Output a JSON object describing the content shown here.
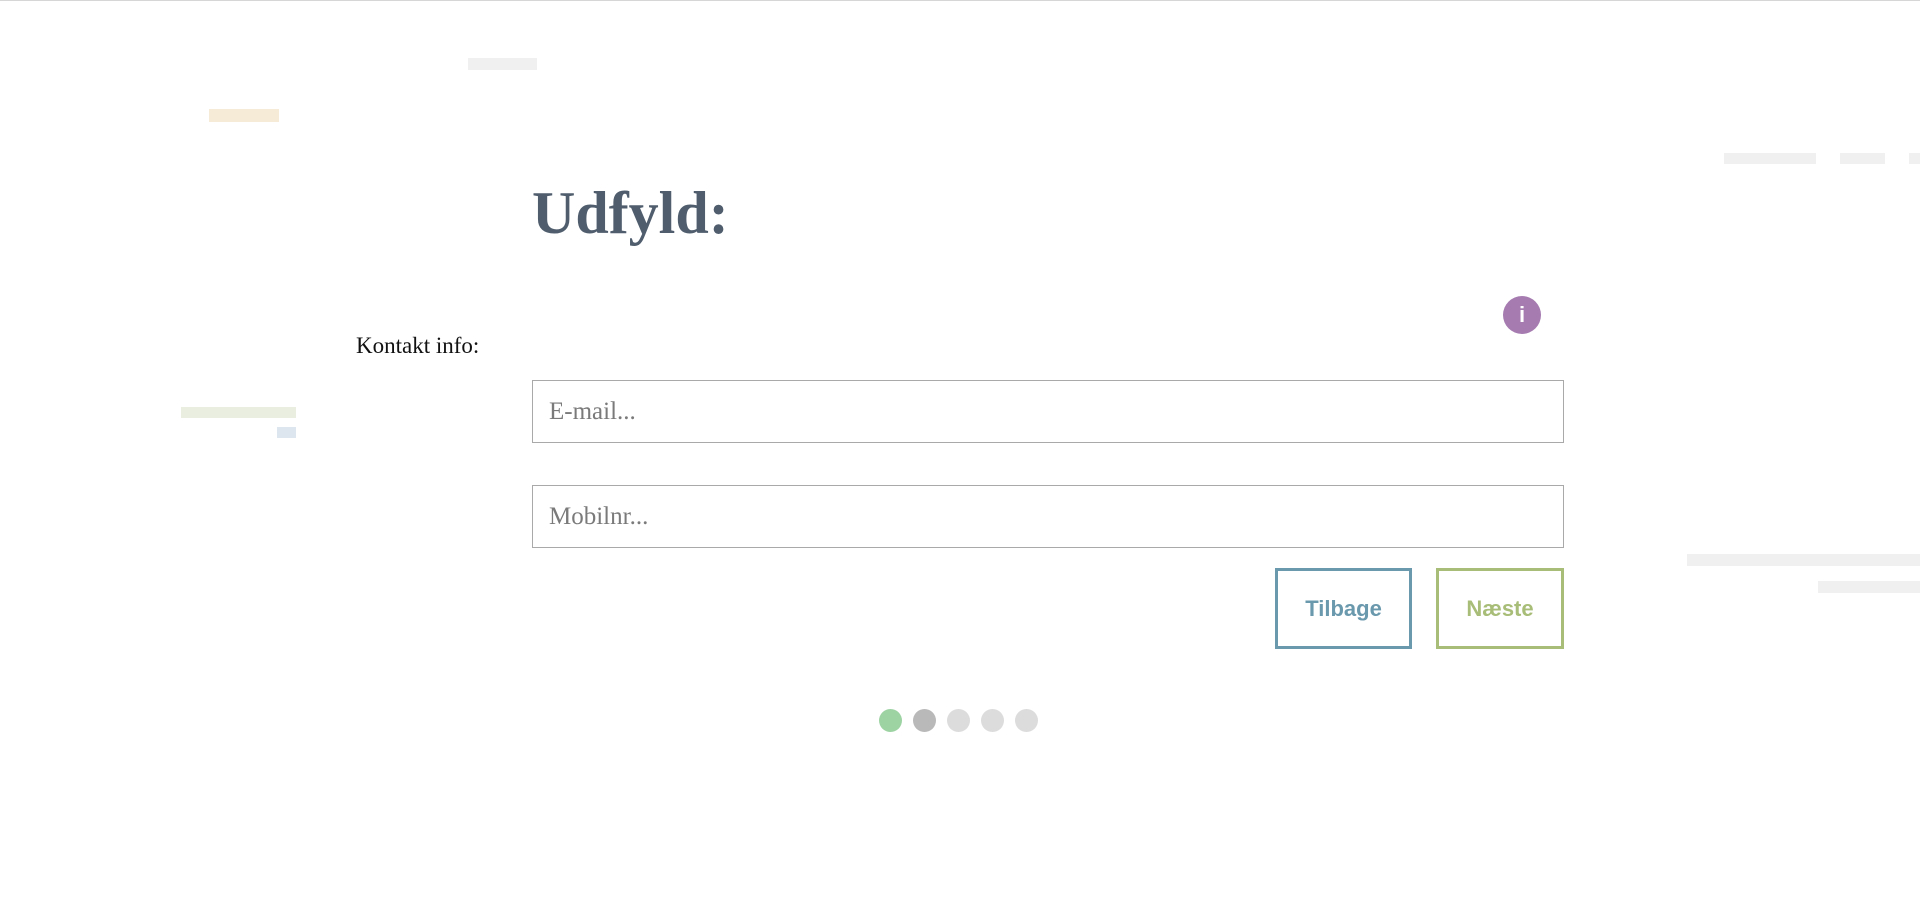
{
  "form": {
    "title": "Udfyld:",
    "info_icon": {
      "name": "info-icon",
      "glyph": "i",
      "color": "#a57bb0"
    },
    "section_label": "Kontakt info:",
    "email": {
      "value": "",
      "placeholder": "E-mail..."
    },
    "mobile": {
      "value": "",
      "placeholder": "Mobilnr..."
    },
    "back_label": "Tilbage",
    "next_label": "Næste"
  },
  "progress": {
    "total_steps": 5,
    "current_step": 2,
    "colors": {
      "completed": "#9dd3a3",
      "current": "#b9b9b9",
      "upcoming": "#dcdcdc"
    }
  },
  "colors": {
    "title": "#4f5d6d",
    "back_button": "#6a98ad",
    "next_button": "#a8bd77"
  }
}
